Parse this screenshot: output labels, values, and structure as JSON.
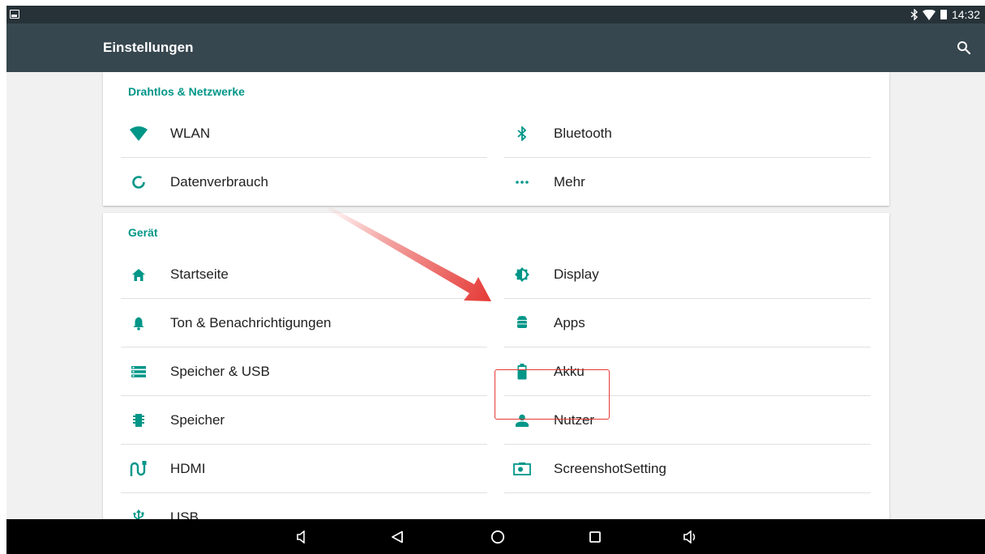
{
  "status_bar": {
    "time": "14:32"
  },
  "app_bar": {
    "title": "Einstellungen"
  },
  "sections": [
    {
      "header": "Drahtlos & Netzwerke",
      "items": [
        {
          "label": "WLAN",
          "icon": "wifi-icon"
        },
        {
          "label": "Bluetooth",
          "icon": "bluetooth-icon"
        },
        {
          "label": "Datenverbrauch",
          "icon": "data-usage-icon"
        },
        {
          "label": "Mehr",
          "icon": "more-icon"
        }
      ]
    },
    {
      "header": "Gerät",
      "items": [
        {
          "label": "Startseite",
          "icon": "home-icon"
        },
        {
          "label": "Display",
          "icon": "brightness-icon"
        },
        {
          "label": "Ton & Benachrichtigungen",
          "icon": "bell-icon"
        },
        {
          "label": "Apps",
          "icon": "android-icon"
        },
        {
          "label": "Speicher & USB",
          "icon": "storage-icon"
        },
        {
          "label": "Akku",
          "icon": "battery-icon"
        },
        {
          "label": "Speicher",
          "icon": "memory-icon"
        },
        {
          "label": "Nutzer",
          "icon": "person-icon"
        },
        {
          "label": "HDMI",
          "icon": "hdmi-icon"
        },
        {
          "label": "ScreenshotSetting",
          "icon": "screenshot-icon"
        },
        {
          "label": "USB",
          "icon": "usb-icon"
        }
      ]
    }
  ],
  "colors": {
    "accent": "#009688",
    "app_bar": "#37474f",
    "status_bar": "#263238",
    "highlight": "#e53935"
  }
}
